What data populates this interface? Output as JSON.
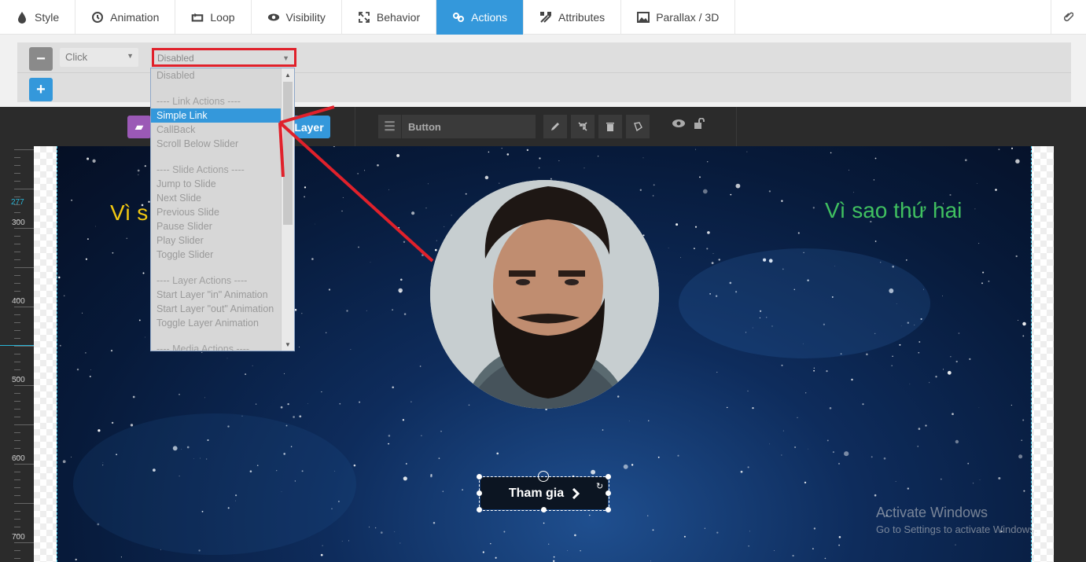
{
  "tabs": [
    {
      "label": "Style",
      "icon": "drop-icon",
      "active": false
    },
    {
      "label": "Animation",
      "icon": "history-icon",
      "active": false
    },
    {
      "label": "Loop",
      "icon": "loop-icon",
      "active": false
    },
    {
      "label": "Visibility",
      "icon": "eye-icon",
      "active": false
    },
    {
      "label": "Behavior",
      "icon": "expand-icon",
      "active": false
    },
    {
      "label": "Actions",
      "icon": "link-icon",
      "active": true
    },
    {
      "label": "Attributes",
      "icon": "tools-icon",
      "active": false
    },
    {
      "label": "Parallax / 3D",
      "icon": "image-icon",
      "active": false
    }
  ],
  "action_panel": {
    "event_select": "Click",
    "action_select": "Disabled"
  },
  "dropdown": {
    "items": [
      {
        "label": "Disabled",
        "type": "option"
      },
      {
        "label": "",
        "type": "gap"
      },
      {
        "label": "---- Link Actions ----",
        "type": "group"
      },
      {
        "label": "Simple Link",
        "type": "selected"
      },
      {
        "label": "CallBack",
        "type": "option"
      },
      {
        "label": "Scroll Below Slider",
        "type": "option"
      },
      {
        "label": "",
        "type": "gap"
      },
      {
        "label": "---- Slide Actions ----",
        "type": "group"
      },
      {
        "label": "Jump to Slide",
        "type": "option"
      },
      {
        "label": "Next Slide",
        "type": "option"
      },
      {
        "label": "Previous Slide",
        "type": "option"
      },
      {
        "label": "Pause Slider",
        "type": "option"
      },
      {
        "label": "Play Slider",
        "type": "option"
      },
      {
        "label": "Toggle Slider",
        "type": "option"
      },
      {
        "label": "",
        "type": "gap"
      },
      {
        "label": "---- Layer Actions ----",
        "type": "group"
      },
      {
        "label": "Start Layer \"in\" Animation",
        "type": "option"
      },
      {
        "label": "Start Layer \"out\" Animation",
        "type": "option"
      },
      {
        "label": "Toggle Layer Animation",
        "type": "option"
      },
      {
        "label": "",
        "type": "gap"
      },
      {
        "label": "---- Media Actions ----",
        "type": "group"
      }
    ]
  },
  "toolbar": {
    "layer_button": "Layer",
    "layer_name": "Button"
  },
  "ruler": {
    "marker": "277",
    "labels": [
      "300",
      "400",
      "500",
      "600",
      "700"
    ]
  },
  "slide": {
    "text_left": "Vì s",
    "text_right": "Vì sao thứ hai",
    "cta_label": "Tham gia",
    "colors": {
      "left_text": "#f2c811",
      "right_text": "#40c060",
      "accent": "#3498db"
    }
  },
  "watermark": {
    "title": "Activate Windows",
    "subtitle": "Go to Settings to activate Windows."
  }
}
